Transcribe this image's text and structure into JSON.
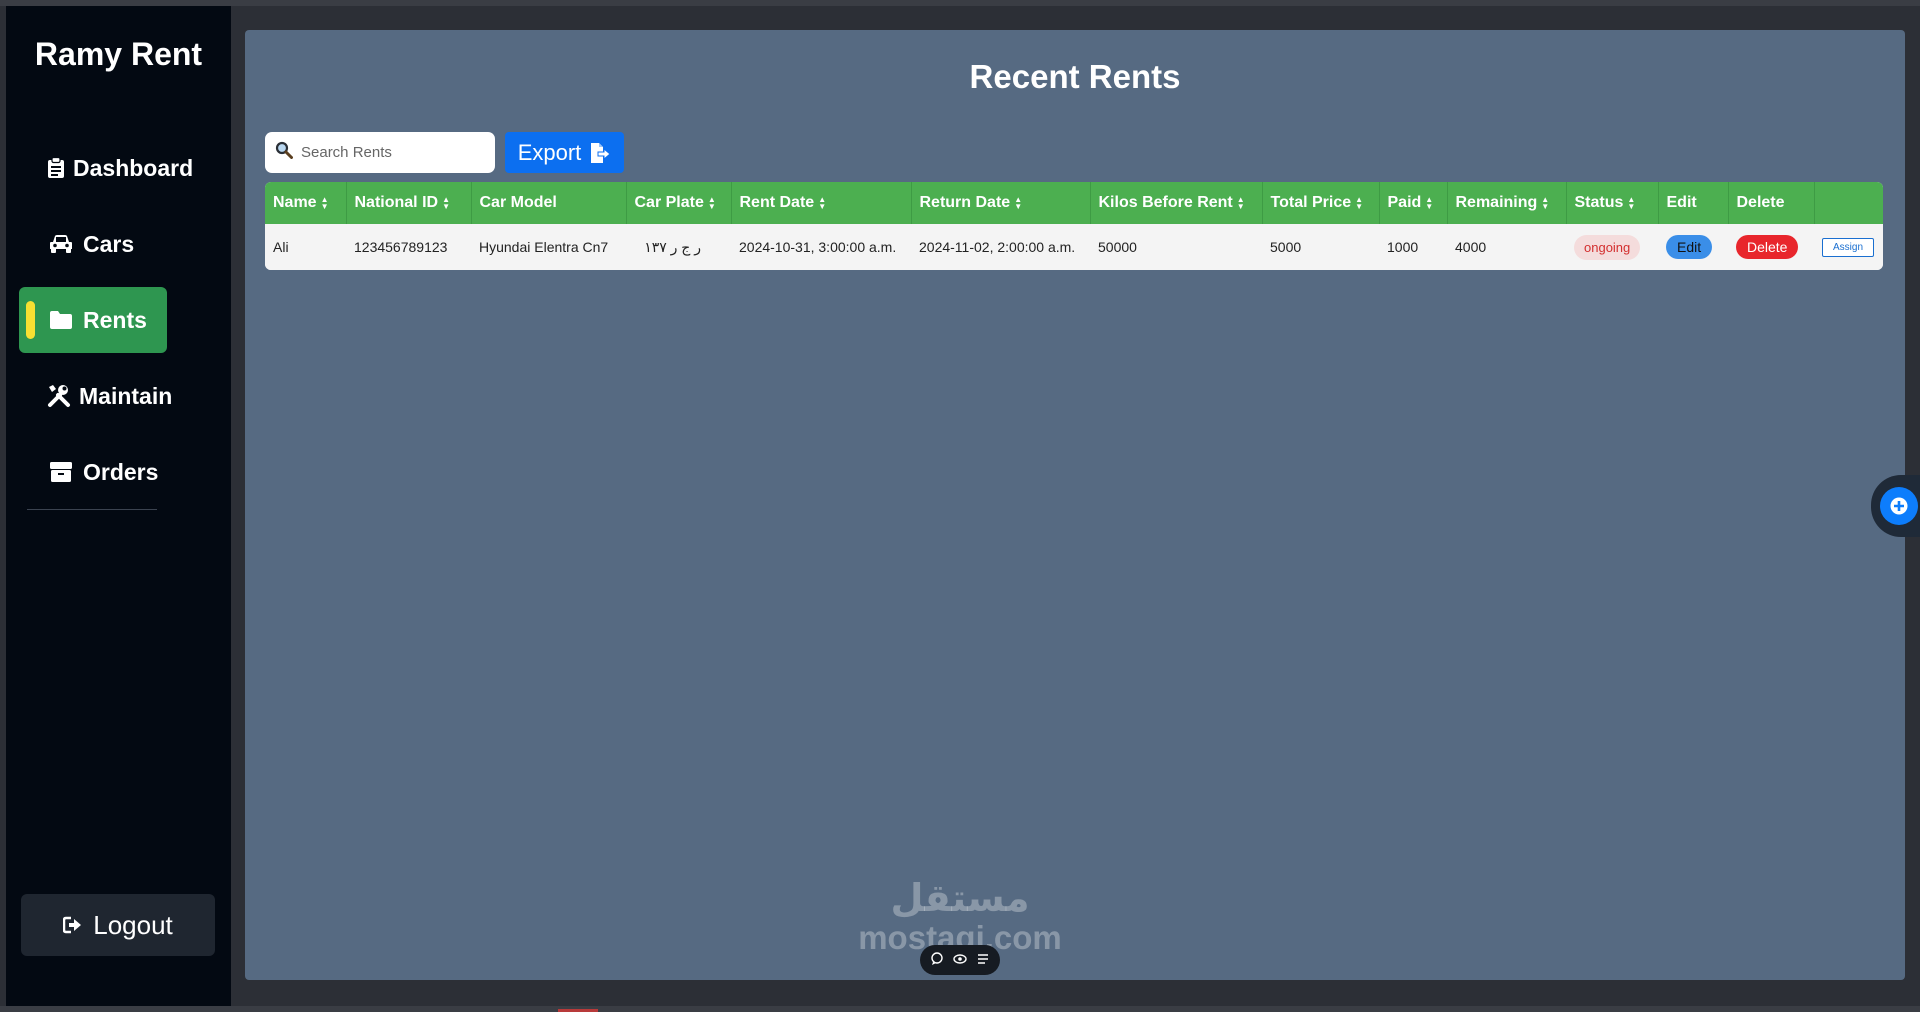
{
  "sidebar": {
    "brand": "Ramy Rent",
    "items": [
      {
        "label": "Dashboard",
        "icon": "clipboard-icon"
      },
      {
        "label": "Cars",
        "icon": "car-icon"
      },
      {
        "label": "Rents",
        "icon": "folder-icon",
        "active": true
      },
      {
        "label": "Maintain",
        "icon": "tools-icon"
      },
      {
        "label": "Orders",
        "icon": "box-icon"
      }
    ],
    "logout_label": "Logout"
  },
  "main": {
    "title": "Recent Rents",
    "search_placeholder": "Search Rents",
    "export_label": "Export"
  },
  "table": {
    "columns": [
      "Name",
      "National ID",
      "Car Model",
      "Car Plate",
      "Rent Date",
      "Return Date",
      "Kilos Before Rent",
      "Total Price",
      "Paid",
      "Remaining",
      "Status",
      "Edit",
      "Delete",
      ""
    ],
    "rows": [
      {
        "name": "Ali",
        "national_id": "123456789123",
        "car_model": "Hyundai Elentra Cn7",
        "car_plate": "ر ج ر ١٣٧",
        "rent_date": "2024-10-31, 3:00:00 a.m.",
        "return_date": "2024-11-02, 2:00:00 a.m.",
        "kilos_before_rent": "50000",
        "total_price": "5000",
        "paid": "1000",
        "remaining": "4000",
        "status": "ongoing",
        "edit_label": "Edit",
        "delete_label": "Delete",
        "assign_label": "Assign"
      }
    ]
  },
  "watermark": {
    "arabic": "مستقل",
    "latin": "mostaqi.com"
  },
  "colors": {
    "sidebar_bg": "#030912",
    "main_bg": "#566a82",
    "header_green": "#4caf50",
    "active_green": "#2e9650",
    "indicator_yellow": "#f7e032",
    "export_blue": "#0c6ff0"
  }
}
